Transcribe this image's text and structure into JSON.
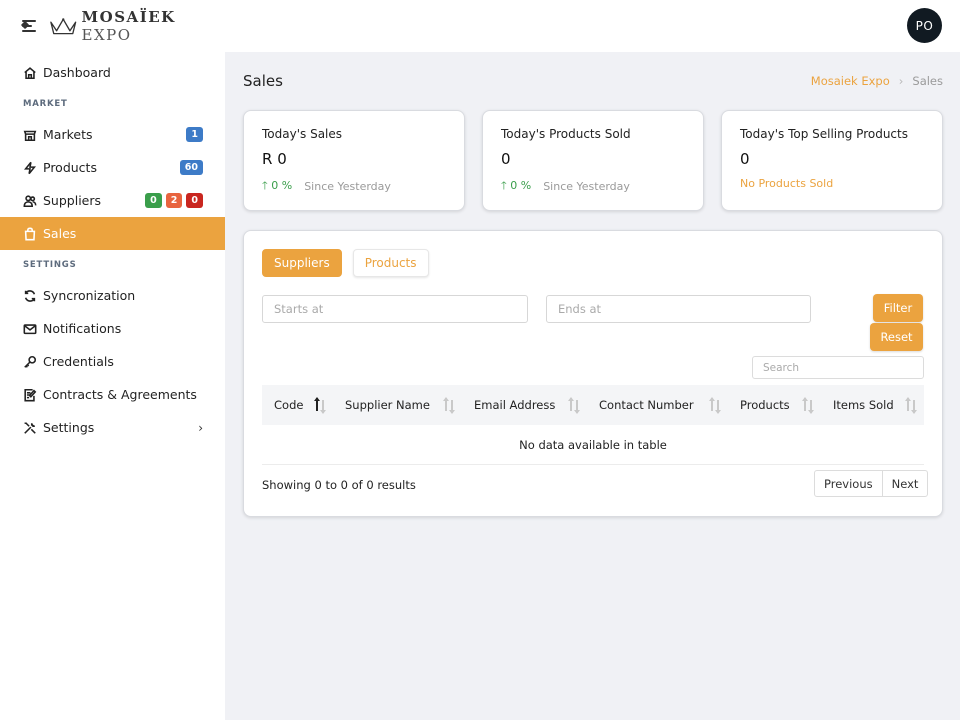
{
  "brand": {
    "name_bold": "MOSAÏEK",
    "name_light": "EXPO"
  },
  "sidebar": {
    "items_top": [
      {
        "label": "Dashboard",
        "icon": "home-icon"
      }
    ],
    "market_title": "MARKET",
    "market_items": [
      {
        "label": "Markets",
        "icon": "shop-icon",
        "badges": [
          {
            "text": "1",
            "color": "blue"
          }
        ]
      },
      {
        "label": "Products",
        "icon": "bolt-icon",
        "badges": [
          {
            "text": "60",
            "color": "blue"
          }
        ]
      },
      {
        "label": "Suppliers",
        "icon": "users-icon",
        "badges": [
          {
            "text": "0",
            "color": "green"
          },
          {
            "text": "2",
            "color": "orange"
          },
          {
            "text": "0",
            "color": "red"
          }
        ]
      },
      {
        "label": "Sales",
        "icon": "bag-icon",
        "active": true
      }
    ],
    "settings_title": "SETTINGS",
    "settings_items": [
      {
        "label": "Syncronization",
        "icon": "sync-icon"
      },
      {
        "label": "Notifications",
        "icon": "envelope-icon"
      },
      {
        "label": "Credentials",
        "icon": "key-icon"
      },
      {
        "label": "Contracts & Agreements",
        "icon": "contract-icon"
      },
      {
        "label": "Settings",
        "icon": "tools-icon",
        "chevron": "›"
      }
    ]
  },
  "header": {
    "avatar_initials": "PO"
  },
  "page": {
    "title": "Sales",
    "breadcrumb": {
      "home": "Mosaiek Expo",
      "sep": "›",
      "current": "Sales"
    }
  },
  "stats": [
    {
      "title": "Today's Sales",
      "value": "R 0",
      "change": "0 %",
      "since": "Since Yesterday"
    },
    {
      "title": "Today's Products Sold",
      "value": "0",
      "change": "0 %",
      "since": "Since Yesterday"
    },
    {
      "title": "Today's Top Selling Products",
      "value": "0",
      "note": "No Products Sold"
    }
  ],
  "panel": {
    "tabs": {
      "suppliers": "Suppliers",
      "products": "Products"
    },
    "starts_placeholder": "Starts at",
    "ends_placeholder": "Ends at",
    "filter": "Filter",
    "reset": "Reset",
    "search_placeholder": "Search",
    "columns": [
      "Code",
      "Supplier Name",
      "Email Address",
      "Contact Number",
      "Products",
      "Items Sold"
    ],
    "empty": "No data available in table",
    "showing": "Showing 0 to 0 of 0 results",
    "previous": "Previous",
    "next": "Next"
  },
  "colors": {
    "accent": "#eba33f",
    "green": "#3a9e4b",
    "avatar": "#111a22"
  }
}
